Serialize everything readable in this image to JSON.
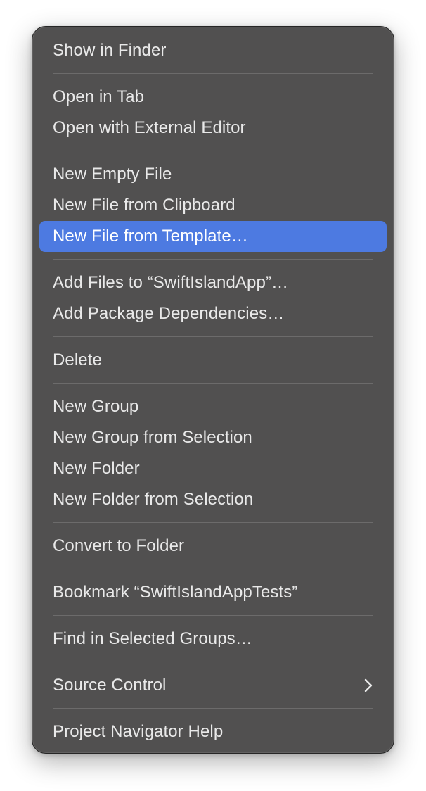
{
  "menu": {
    "groups": [
      {
        "items": [
          {
            "label": "Show in Finder"
          }
        ]
      },
      {
        "items": [
          {
            "label": "Open in Tab"
          },
          {
            "label": "Open with External Editor"
          }
        ]
      },
      {
        "items": [
          {
            "label": "New Empty File"
          },
          {
            "label": "New File from Clipboard"
          },
          {
            "label": "New File from Template…",
            "highlighted": true
          }
        ]
      },
      {
        "items": [
          {
            "label": "Add Files to “SwiftIslandApp”…"
          },
          {
            "label": "Add Package Dependencies…"
          }
        ]
      },
      {
        "items": [
          {
            "label": "Delete"
          }
        ]
      },
      {
        "items": [
          {
            "label": "New Group"
          },
          {
            "label": "New Group from Selection"
          },
          {
            "label": "New Folder"
          },
          {
            "label": "New Folder from Selection"
          }
        ]
      },
      {
        "items": [
          {
            "label": "Convert to Folder"
          }
        ]
      },
      {
        "items": [
          {
            "label": "Bookmark “SwiftIslandAppTests”"
          }
        ]
      },
      {
        "items": [
          {
            "label": "Find in Selected Groups…"
          }
        ]
      },
      {
        "items": [
          {
            "label": "Source Control",
            "submenu_icon": "chevron-right-icon"
          }
        ]
      },
      {
        "items": [
          {
            "label": "Project Navigator Help"
          }
        ]
      }
    ]
  },
  "colors": {
    "menu_background": "#515050",
    "text": "#e9e9e9",
    "highlight": "#4d7ae1",
    "separator": "#6c6b6b"
  }
}
